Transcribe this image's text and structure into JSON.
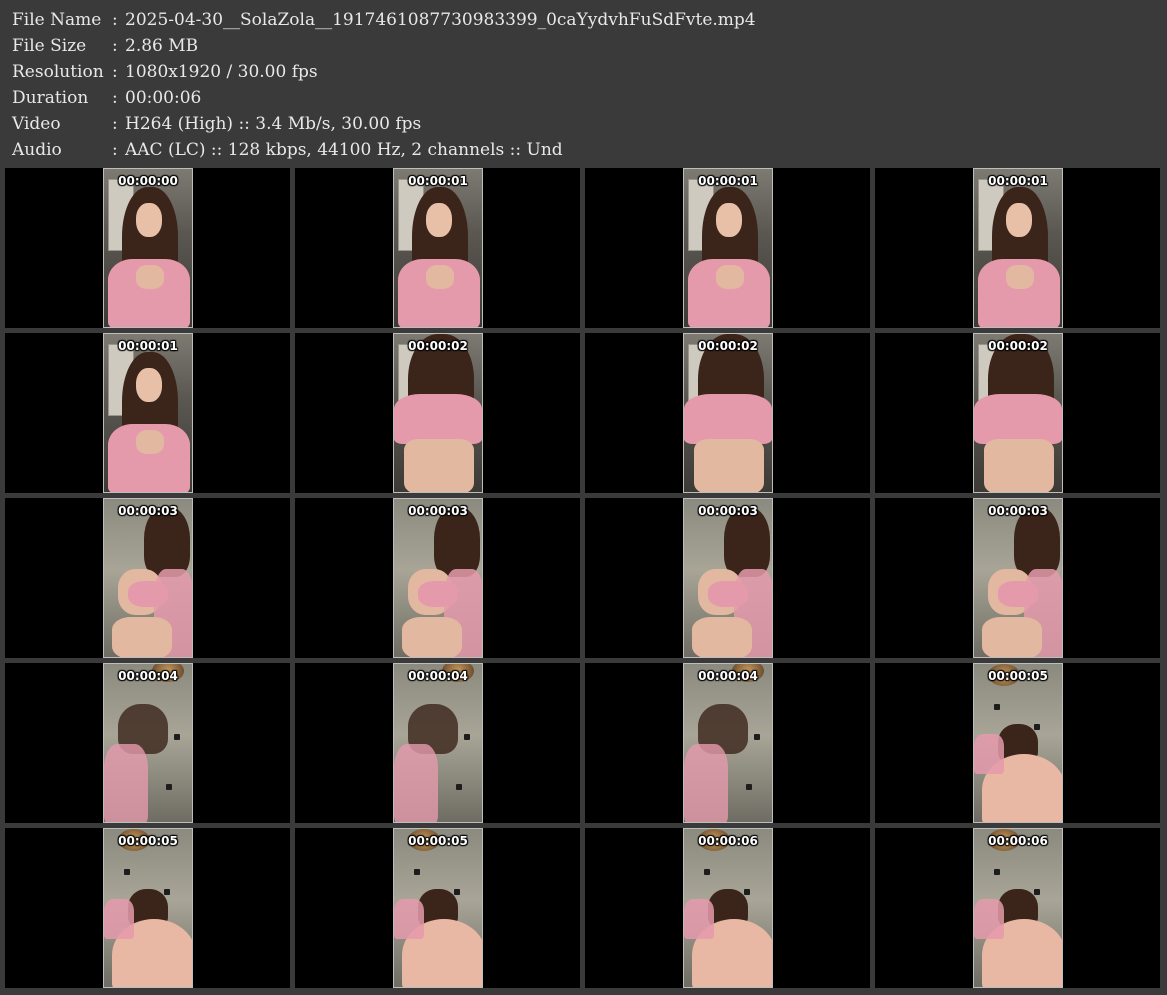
{
  "info": [
    {
      "key": "File Name",
      "sep": ":",
      "value": "2025-04-30__SolaZola__1917461087730983399_0caYydvhFuSdFvte.mp4"
    },
    {
      "key": "File Size",
      "sep": ":",
      "value": "2.86 MB"
    },
    {
      "key": "Resolution",
      "sep": ":",
      "value": "1080x1920 / 30.00 fps"
    },
    {
      "key": "Duration",
      "sep": ":",
      "value": "00:00:06"
    },
    {
      "key": "Video",
      "sep": ":",
      "value": "H264 (High) :: 3.4 Mb/s, 30.00 fps"
    },
    {
      "key": "Audio",
      "sep": ":",
      "value": "AAC (LC) :: 128 kbps, 44100 Hz, 2 channels :: Und"
    }
  ],
  "thumbnails": [
    {
      "time": "00:00:00",
      "scene": "room"
    },
    {
      "time": "00:00:01",
      "scene": "room"
    },
    {
      "time": "00:00:01",
      "scene": "room"
    },
    {
      "time": "00:00:01",
      "scene": "room"
    },
    {
      "time": "00:00:01",
      "scene": "room"
    },
    {
      "time": "00:00:02",
      "scene": "crop"
    },
    {
      "time": "00:00:02",
      "scene": "crop"
    },
    {
      "time": "00:00:02",
      "scene": "crop"
    },
    {
      "time": "00:00:03",
      "scene": "wall"
    },
    {
      "time": "00:00:03",
      "scene": "wall"
    },
    {
      "time": "00:00:03",
      "scene": "wall"
    },
    {
      "time": "00:00:03",
      "scene": "wall"
    },
    {
      "time": "00:00:04",
      "scene": "blur"
    },
    {
      "time": "00:00:04",
      "scene": "blur"
    },
    {
      "time": "00:00:04",
      "scene": "blur"
    },
    {
      "time": "00:00:05",
      "scene": "lamp"
    },
    {
      "time": "00:00:05",
      "scene": "lamp"
    },
    {
      "time": "00:00:05",
      "scene": "lamp"
    },
    {
      "time": "00:00:06",
      "scene": "lamp"
    },
    {
      "time": "00:00:06",
      "scene": "lamp"
    }
  ]
}
